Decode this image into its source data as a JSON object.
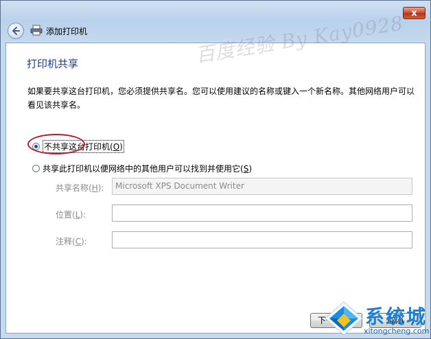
{
  "window": {
    "title": "添加打印机",
    "close_label": "x"
  },
  "page": {
    "title": "打印机共享",
    "description": "如果要共享这台打印机，您必须提供共享名。您可以使用建议的名称或键入一个新名称。其他网络用户可以看见该共享名。"
  },
  "options": {
    "no_share": {
      "label": "不共享这台打印机(",
      "accel": "O",
      "suffix": ")",
      "selected": true
    },
    "share": {
      "label": "共享此打印机以便网络中的其他用户可以找到并使用它(",
      "accel": "S",
      "suffix": ")",
      "selected": false
    }
  },
  "fields": {
    "share_name": {
      "label": "共享名称(",
      "accel": "H",
      "suffix": "):",
      "value": "Microsoft XPS Document Writer"
    },
    "location": {
      "label": "位置(",
      "accel": "L",
      "suffix": "):",
      "value": ""
    },
    "comment": {
      "label": "注释(",
      "accel": "C",
      "suffix": "):",
      "value": ""
    }
  },
  "buttons": {
    "next": "下一步(N)",
    "cancel": "取消"
  },
  "watermark": "百度经验 By Kay0928",
  "brand": {
    "name": "系统城",
    "url": "xitongcheng.com"
  },
  "colors": {
    "title_blue": "#1e3a8a",
    "highlight_red": "#c0162b",
    "brand_blue": "#1a7fd6"
  }
}
